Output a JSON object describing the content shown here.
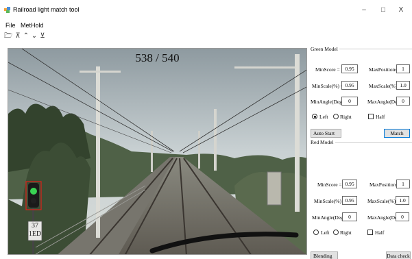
{
  "window": {
    "title": "Railroad light match tool",
    "minimize": "–",
    "maximize": "□",
    "close": "X"
  },
  "menu": {
    "file": "File",
    "method": "MetHold"
  },
  "toolbar": {
    "open": "🗁",
    "first": "⊼",
    "prev": "⌃",
    "next": "⌄",
    "last": "⊻"
  },
  "viewer": {
    "frame_counter": "538 / 540",
    "sign_line1": "37",
    "sign_line2": "1ED",
    "signal_state": "green"
  },
  "green_model": {
    "title": "Green Model",
    "min_score_label": "MinScore =",
    "min_score": "0.95",
    "max_positions_label": "MaxPositions =",
    "max_positions": "1",
    "min_scale_label": "MinScale(%) =",
    "min_scale": "0.95",
    "max_scale_label": "MaxScale(%) =",
    "max_scale": "1.0",
    "min_angle_label": "MinAngle(Deg) =",
    "min_angle": "0",
    "max_angle_label": "MaxAngle(Deg) =",
    "max_angle": "0",
    "left_label": "Left",
    "right_label": "Right",
    "half_label": "Half",
    "side_selected": "left",
    "half_checked": false
  },
  "buttons": {
    "auto_start": "Auto Start",
    "match": "Match",
    "blending_tool": "Blending tool",
    "data_check": "Data check"
  },
  "red_model": {
    "title": "Red Model",
    "min_score_label": "MinScore =",
    "min_score": "0.95",
    "max_positions_label": "MaxPositions =",
    "max_positions": "1",
    "min_scale_label": "MinScale(%) =",
    "min_scale": "0.95",
    "max_scale_label": "MaxScale(%) =",
    "max_scale": "1.0",
    "min_angle_label": "MinAngle(Deg) =",
    "min_angle": "0",
    "max_angle_label": "MaxAngle(Deg) =",
    "max_angle": "0",
    "left_label": "Left",
    "right_label": "Right",
    "half_label": "Half",
    "side_selected": "none",
    "half_checked": false
  },
  "colors": {
    "signal_green": "#39d353",
    "highlight_box": "#e0201a",
    "focus_border": "#0078d7"
  }
}
